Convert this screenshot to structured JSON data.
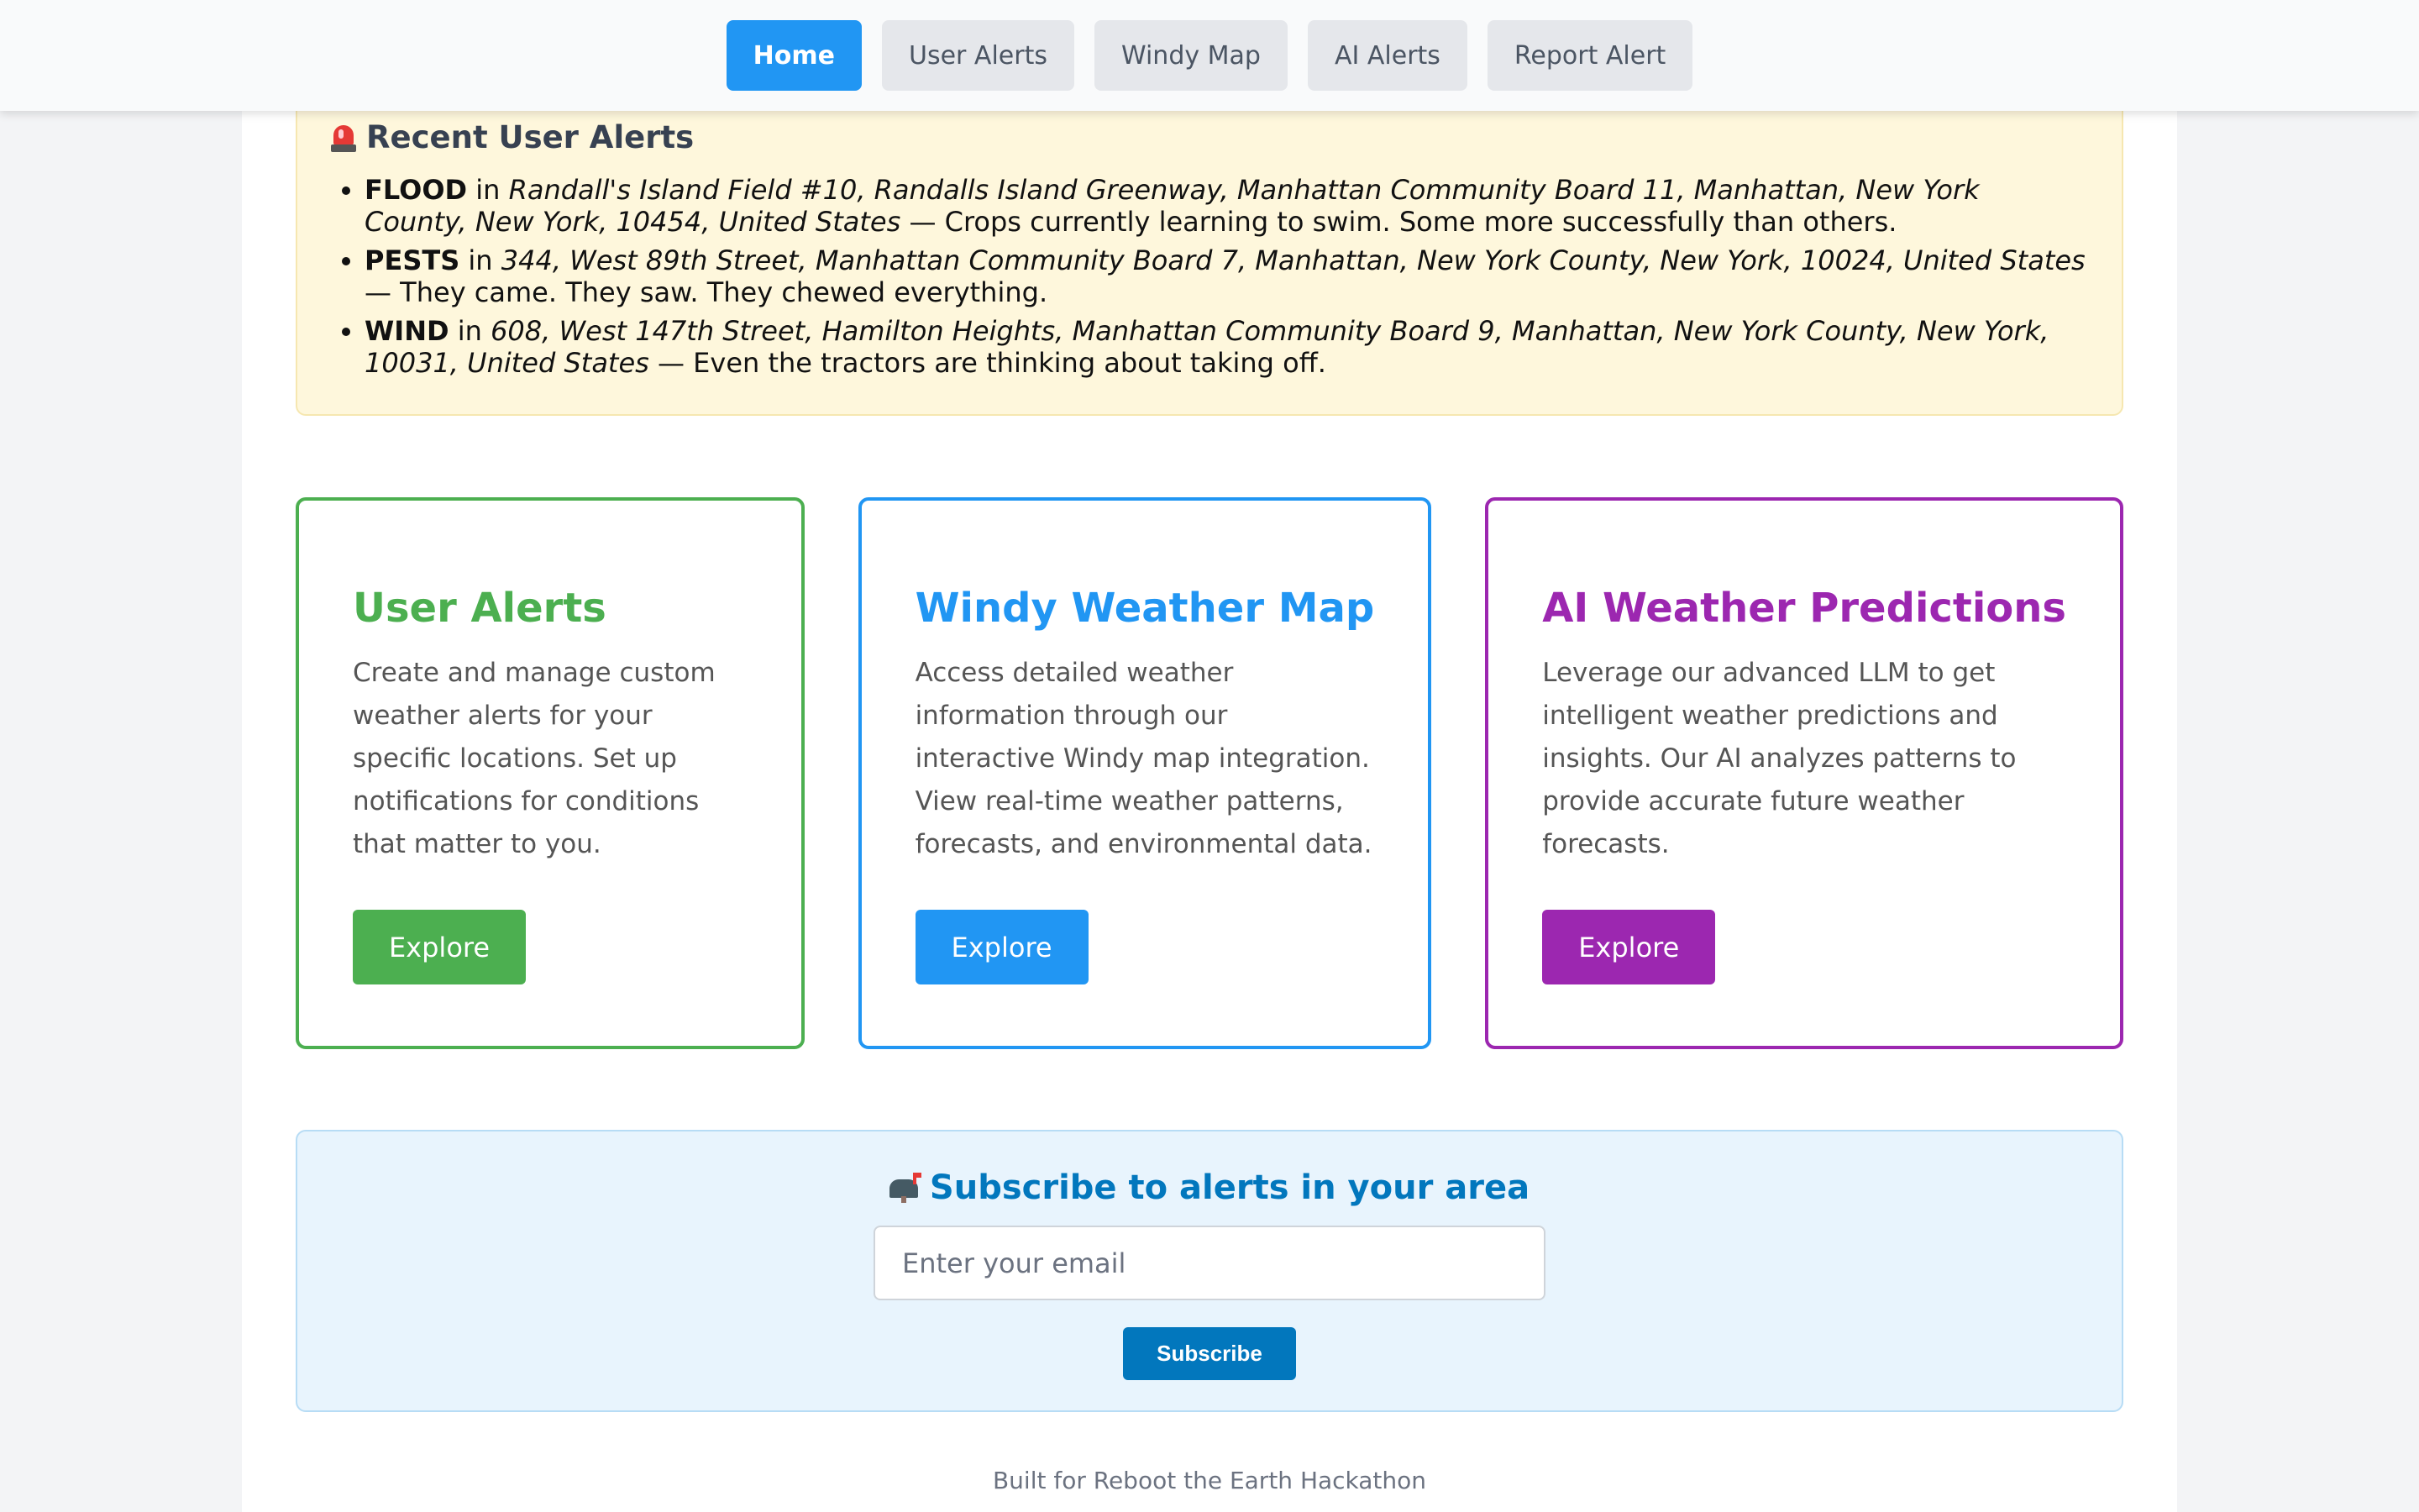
{
  "nav": {
    "items": [
      {
        "label": "Home",
        "active": true
      },
      {
        "label": "User Alerts",
        "active": false
      },
      {
        "label": "Windy Map",
        "active": false
      },
      {
        "label": "AI Alerts",
        "active": false
      },
      {
        "label": "Report Alert",
        "active": false
      }
    ]
  },
  "recent_alerts": {
    "icon": "siren-icon",
    "title": "Recent User Alerts",
    "items": [
      {
        "type": "FLOOD",
        "in": "in",
        "location": "Randall's Island Field #10, Randalls Island Greenway, Manhattan Community Board 11, Manhattan, New York County, New York, 10454, United States",
        "message": "— Crops currently learning to swim. Some more successfully than others."
      },
      {
        "type": "PESTS",
        "in": "in",
        "location": "344, West 89th Street, Manhattan Community Board 7, Manhattan, New York County, New York, 10024, United States",
        "message": "— They came. They saw. They chewed everything."
      },
      {
        "type": "WIND",
        "in": "in",
        "location": "608, West 147th Street, Hamilton Heights, Manhattan Community Board 9, Manhattan, New York County, New York, 10031, United States",
        "message": "— Even the tractors are thinking about taking off."
      }
    ]
  },
  "cards": [
    {
      "title": "User Alerts",
      "description": "Create and manage custom weather alerts for your specific locations. Set up notifications for conditions that matter to you.",
      "button": "Explore",
      "color": "#4caf50"
    },
    {
      "title": "Windy Weather Map",
      "description": "Access detailed weather information through our interactive Windy map integration. View real-time weather patterns, forecasts, and environmental data.",
      "button": "Explore",
      "color": "#2196f3"
    },
    {
      "title": "AI Weather Predictions",
      "description": "Leverage our advanced LLM to get intelligent weather predictions and insights. Our AI analyzes patterns to provide accurate future weather forecasts.",
      "button": "Explore",
      "color": "#9c27b0"
    }
  ],
  "subscribe": {
    "icon": "mailbox-icon",
    "title": "Subscribe to alerts in your area",
    "email_placeholder": "Enter your email",
    "email_value": "",
    "button": "Subscribe"
  },
  "footer": {
    "text": "Built for Reboot the Earth Hackathon"
  },
  "colors": {
    "primary_blue": "#2196f3",
    "green": "#4caf50",
    "purple": "#9c27b0",
    "subscribe_blue": "#0277bd",
    "alert_bg": "#fef7dc"
  }
}
